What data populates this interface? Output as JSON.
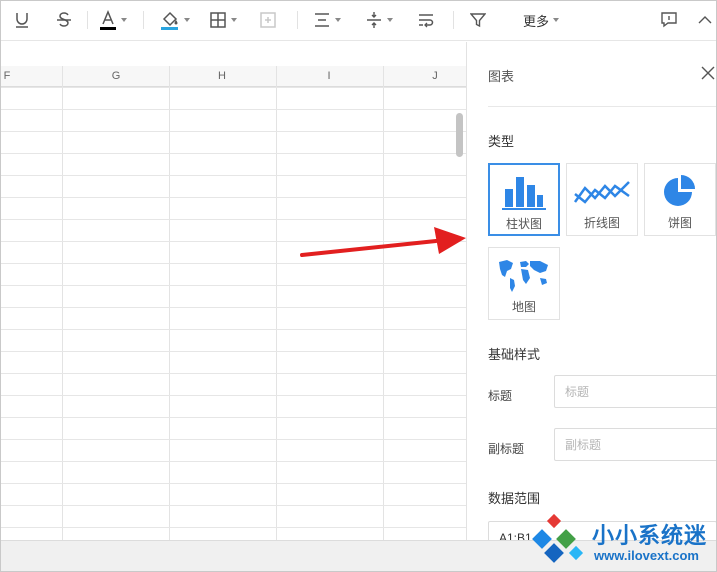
{
  "toolbar": {
    "more_label": "更多"
  },
  "grid": {
    "columns": [
      {
        "label": "F"
      },
      {
        "label": "G"
      },
      {
        "label": "H"
      },
      {
        "label": "I"
      },
      {
        "label": "J"
      }
    ]
  },
  "panel": {
    "title": "图表",
    "type_section": "类型",
    "chart_types": [
      {
        "label": "柱状图",
        "selected": true
      },
      {
        "label": "折线图",
        "selected": false
      },
      {
        "label": "饼图",
        "selected": false
      },
      {
        "label": "地图",
        "selected": false
      }
    ],
    "style_section": "基础样式",
    "title_field": {
      "label": "标题",
      "placeholder": "标题",
      "value": ""
    },
    "subtitle_field": {
      "label": "副标题",
      "placeholder": "副标题",
      "value": ""
    },
    "range_section": "数据范围",
    "range_value": "A1:B1"
  },
  "watermark": {
    "brand": "小小系统迷",
    "url": "www.ilovext.com"
  },
  "colors": {
    "accent_blue": "#3a8ee6",
    "arrow_red": "#e21f1f",
    "text_color_underline": "#000000",
    "fill_color_underline": "#2aa5e0"
  },
  "icons": [
    "underline-icon",
    "strikethrough-icon",
    "font-color-icon",
    "fill-color-icon",
    "border-icon",
    "merge-cells-icon",
    "horizontal-align-icon",
    "vertical-align-icon",
    "wrap-text-icon",
    "filter-icon",
    "comment-icon",
    "collapse-icon",
    "close-icon"
  ]
}
